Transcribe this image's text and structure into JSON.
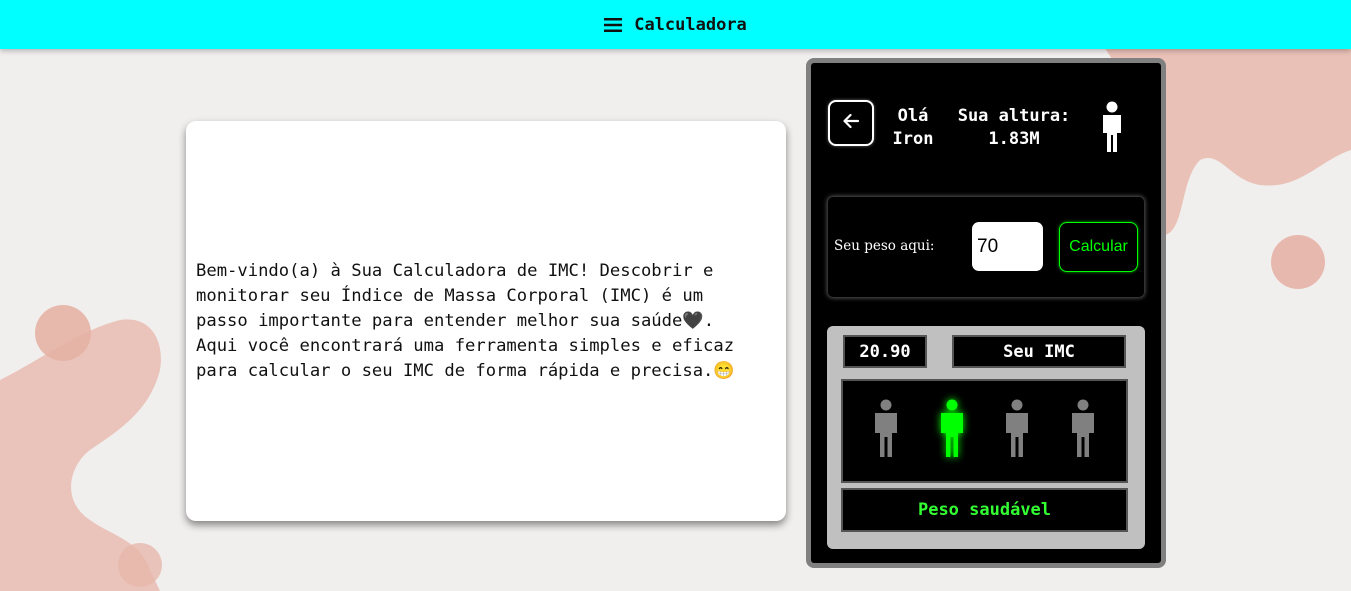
{
  "header": {
    "title": "Calculadora",
    "menu_icon": "hamburger-menu-icon"
  },
  "welcome": {
    "text": "Bem-vindo(a) à Sua Calculadora de IMC! Descobrir e\nmonitorar seu Índice de Massa Corporal (IMC) é um\npasso importante para entender melhor sua saúde🖤.\nAqui você encontrará uma ferramenta simples e eficaz\npara calcular o seu IMC de forma rápida e precisa.😁"
  },
  "panel": {
    "back_icon": "arrow-left-icon",
    "greeting_line1": "Olá",
    "greeting_line2": "Iron",
    "height_line1": "Sua altura:",
    "height_line2": "1.83M",
    "person_icon": "person-icon"
  },
  "weight": {
    "label": "Seu peso aqui:",
    "value": "70",
    "button_label": "Calcular"
  },
  "result": {
    "imc_value": "20.90",
    "imc_label": "Seu IMC",
    "status": "Peso saudável",
    "active_index": 1,
    "figure_count": 4
  },
  "colors": {
    "header_bg": "#00ffff",
    "accent_green": "#00ff00",
    "inactive_figure": "#808080"
  }
}
